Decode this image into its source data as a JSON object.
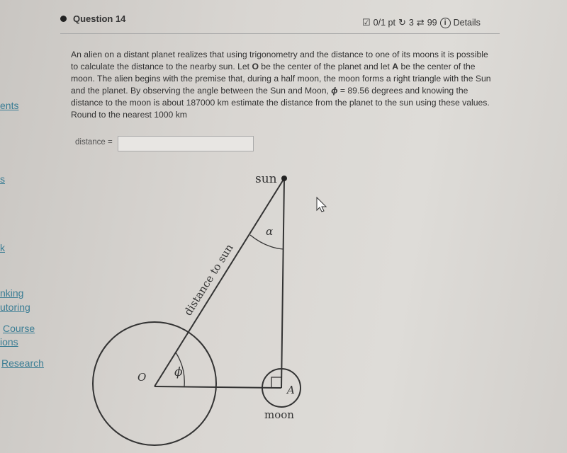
{
  "sidebar": {
    "items": [
      {
        "label": "ents"
      },
      {
        "label": "s"
      },
      {
        "label": "k"
      },
      {
        "label": "nking"
      },
      {
        "label": "utoring"
      },
      {
        "label": "Course"
      },
      {
        "label": "ions"
      },
      {
        "label": "Research"
      }
    ]
  },
  "header": {
    "title": "Question 14",
    "score": "0/1 pt",
    "retries": "3",
    "attempts": "99",
    "details": "Details"
  },
  "question": {
    "text_parts": [
      "An alien on a distant planet realizes that using trigonometry and the distance to one of its moons it is possible to calculate the distance to the nearby sun. Let ",
      "O",
      " be the center of the planet and let ",
      "A",
      " be the center of the moon. The alien begins with the premise that, during a half moon, the moon forms a right triangle with the Sun and the planet. By observing the angle between the Sun and Moon, ",
      "ϕ",
      " = 89.56  degrees and knowing the distance to the moon is about 187000 km estimate the distance from the planet to the sun using these values.  Round to the nearest 1000 km"
    ]
  },
  "answer": {
    "label": "distance =",
    "value": ""
  },
  "diagram": {
    "sun": "sun",
    "moon": "moon",
    "hyp": "distance to sun",
    "alpha": "α",
    "phi": "ϕ",
    "O": "O",
    "A": "A"
  }
}
